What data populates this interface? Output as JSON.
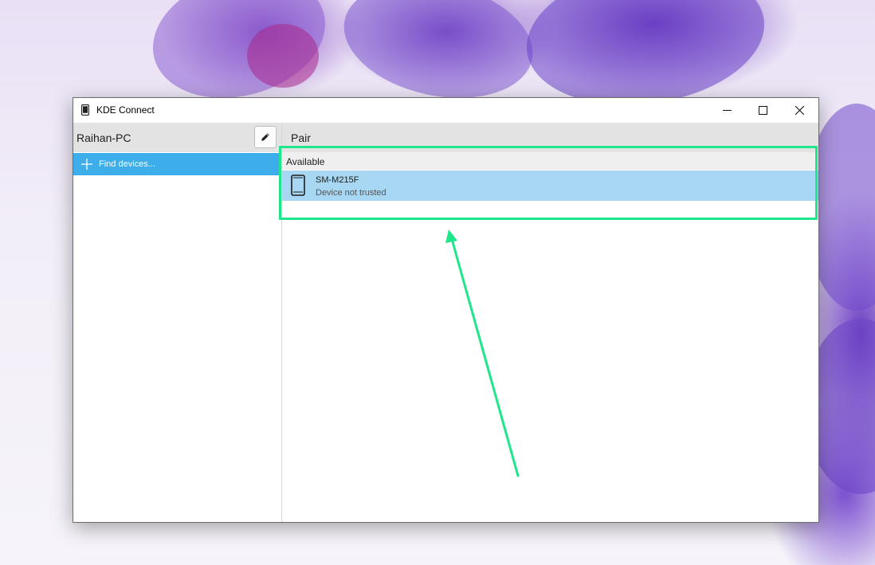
{
  "window": {
    "title": "KDE Connect",
    "controls": {
      "minimize": "—",
      "maximize": "☐",
      "close": "✕"
    }
  },
  "sidebar": {
    "pc_name": "Raihan-PC",
    "edit_icon": "pencil-icon",
    "find_devices_label": "Find devices..."
  },
  "main": {
    "header": "Pair",
    "section_label": "Available",
    "devices": [
      {
        "name": "SM-M215F",
        "status": "Device not trusted",
        "icon": "smartphone-icon"
      }
    ]
  },
  "annotation": {
    "color": "#1ee68a"
  },
  "colors": {
    "selection": "#3daee9",
    "device_highlight": "#a7d7f2",
    "header_bg": "#e3e3e3"
  }
}
